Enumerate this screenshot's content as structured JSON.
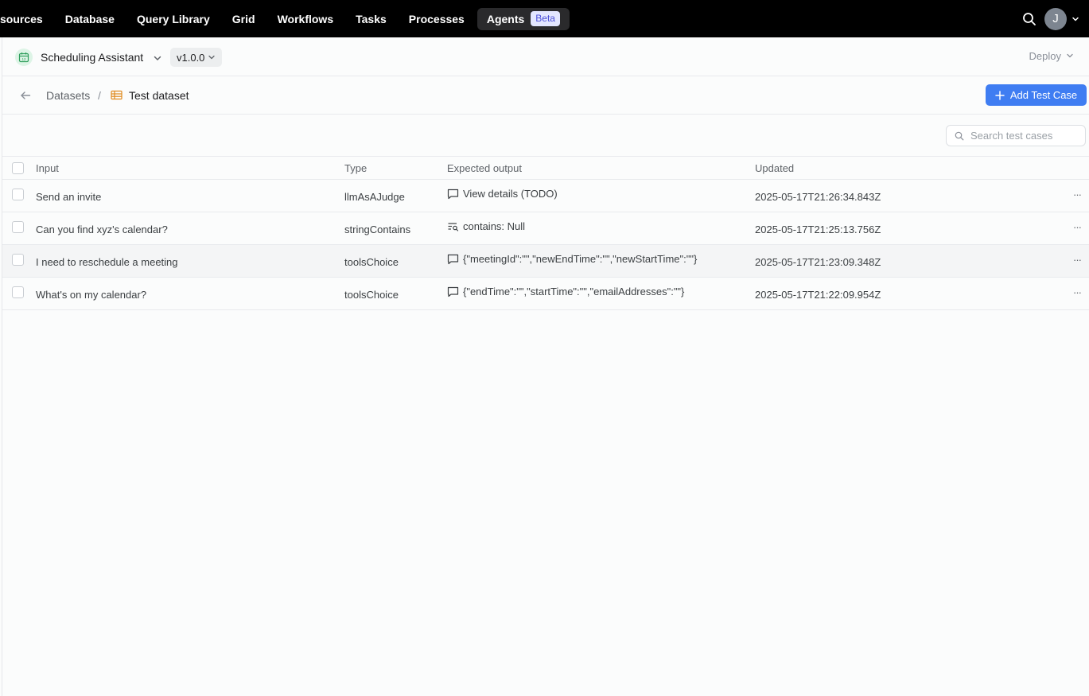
{
  "nav": {
    "items": [
      "sources",
      "Database",
      "Query Library",
      "Grid",
      "Workflows",
      "Tasks",
      "Processes"
    ],
    "agents_label": "Agents",
    "beta_badge": "Beta",
    "user_initial": "J"
  },
  "agent": {
    "name": "Scheduling Assistant",
    "version": "v1.0.0",
    "deploy_label": "Deploy"
  },
  "breadcrumb": {
    "parent": "Datasets",
    "separator": "/",
    "current": "Test dataset"
  },
  "actions": {
    "add_test_case": "Add Test Case"
  },
  "search": {
    "placeholder": "Search test cases"
  },
  "table": {
    "columns": [
      "Input",
      "Type",
      "Expected output",
      "Updated"
    ],
    "rows": [
      {
        "input": "Send an invite",
        "type": "llmAsAJudge",
        "expected_icon": "message-icon",
        "expected": "View details (TODO)",
        "updated": "2025-05-17T21:26:34.843Z"
      },
      {
        "input": "Can you find xyz's calendar?",
        "type": "stringContains",
        "expected_icon": "text-search-icon",
        "expected": "contains: Null",
        "updated": "2025-05-17T21:25:13.756Z"
      },
      {
        "input": "I need to reschedule a meeting",
        "type": "toolsChoice",
        "expected_icon": "message-icon",
        "expected": "{\"meetingId\":\"\",\"newEndTime\":\"\",\"newStartTime\":\"\"}",
        "updated": "2025-05-17T21:23:09.348Z"
      },
      {
        "input": "What's on my calendar?",
        "type": "toolsChoice",
        "expected_icon": "message-icon",
        "expected": "{\"endTime\":\"\",\"startTime\":\"\",\"emailAddresses\":\"\"}",
        "updated": "2025-05-17T21:22:09.954Z"
      }
    ],
    "more_label": "···"
  },
  "colors": {
    "nav_bg": "#000000",
    "primary": "#3f7df2",
    "beta_bg": "#e3e6ff",
    "beta_text": "#4b4fd8",
    "agent_icon_green": "#2f9e5c",
    "dataset_icon_orange": "#e08a1e"
  }
}
